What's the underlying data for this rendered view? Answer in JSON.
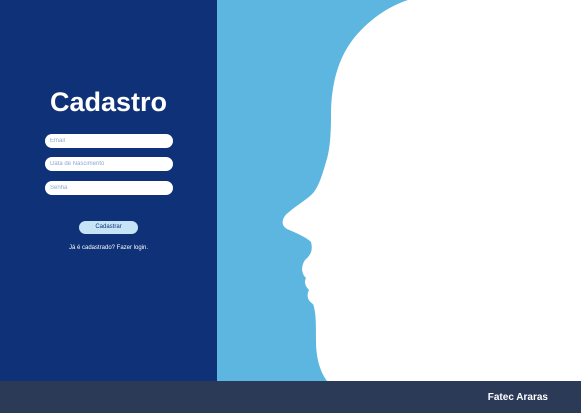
{
  "signup": {
    "title": "Cadastro",
    "email_placeholder": "Email",
    "birthdate_placeholder": "Data de Nascimento",
    "password_placeholder": "Senha",
    "register_label": "Cadastrar",
    "login_link_label": "Já é cadastrado? Fazer login."
  },
  "footer": {
    "brand": "Fatec Araras"
  },
  "colors": {
    "left_panel": "#0f3177",
    "right_panel": "#5db6e0",
    "footer": "#2a3a57",
    "button": "#c7e4f7",
    "silhouette": "#ffffff"
  },
  "icons": {
    "illustration": "face-profile-silhouette"
  }
}
